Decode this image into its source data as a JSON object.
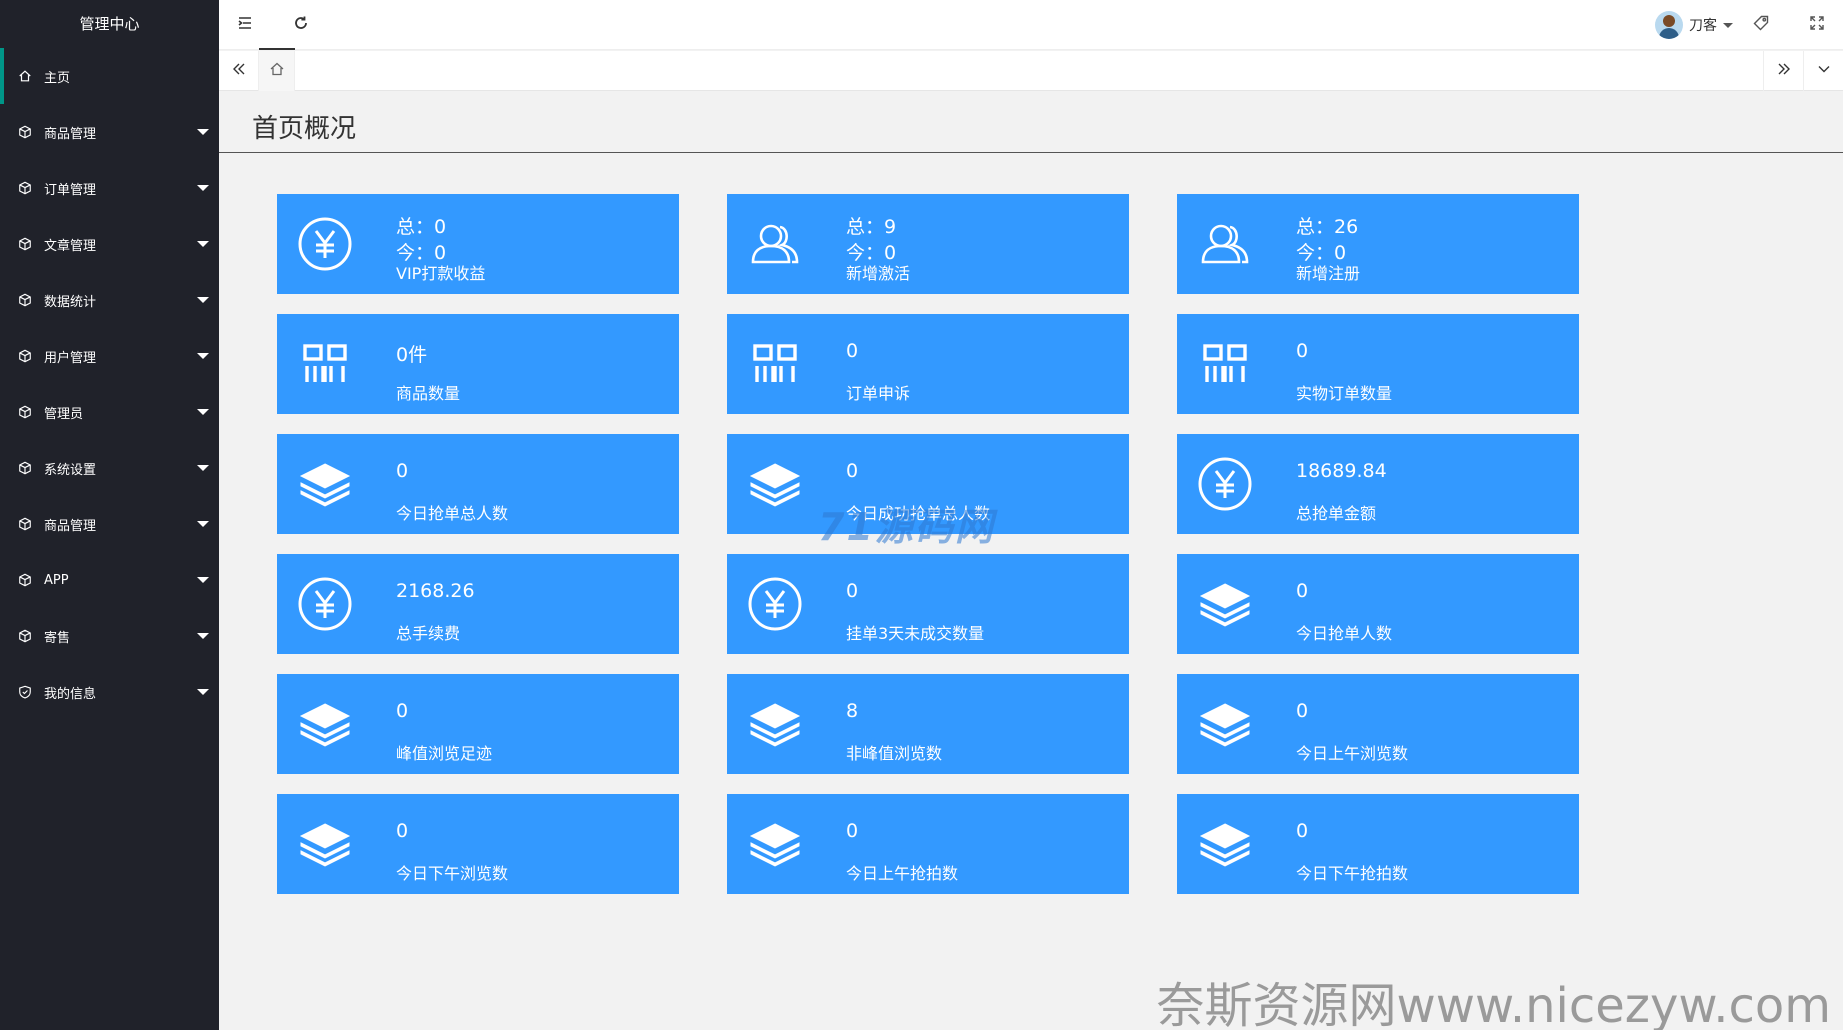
{
  "sidebar": {
    "logo": "管理中心",
    "items": [
      {
        "label": "主页",
        "active": true
      },
      {
        "label": "商品管理"
      },
      {
        "label": "订单管理"
      },
      {
        "label": "文章管理"
      },
      {
        "label": "数据统计"
      },
      {
        "label": "用户管理"
      },
      {
        "label": "管理员"
      },
      {
        "label": "系统设置"
      },
      {
        "label": "商品管理"
      },
      {
        "label": "APP"
      },
      {
        "label": "寄售"
      },
      {
        "label": "我的信息"
      }
    ]
  },
  "header": {
    "username": "刀客",
    "icons": [
      "menu-fold-icon",
      "refresh-icon",
      "tag-icon",
      "fullscreen-icon"
    ]
  },
  "tabs": {
    "home_icon": "home-icon"
  },
  "page": {
    "title": "首页概况"
  },
  "cards": [
    {
      "icon": "yuan-icon",
      "total": "总：0",
      "today": "今：0",
      "label": "VIP打款收益"
    },
    {
      "icon": "users-icon",
      "total": "总：9",
      "today": "今：0",
      "label": "新增激活"
    },
    {
      "icon": "users-icon",
      "total": "总：26",
      "today": "今：0",
      "label": "新增注册"
    },
    {
      "icon": "grid-icon",
      "value": "0件",
      "label": "商品数量"
    },
    {
      "icon": "grid-icon",
      "value": "0",
      "label": "订单申诉"
    },
    {
      "icon": "grid-icon",
      "value": "0",
      "label": "实物订单数量"
    },
    {
      "icon": "layers-icon",
      "value": "0",
      "label": "今日抢单总人数"
    },
    {
      "icon": "layers-icon",
      "value": "0",
      "label": "今日成功抢单总人数"
    },
    {
      "icon": "yuan-icon",
      "value": "18689.84",
      "label": "总抢单金额"
    },
    {
      "icon": "yuan-icon",
      "value": "2168.26",
      "label": "总手续费"
    },
    {
      "icon": "yuan-icon",
      "value": "0",
      "label": "挂单3天未成交数量"
    },
    {
      "icon": "layers-icon",
      "value": "0",
      "label": "今日抢单人数"
    },
    {
      "icon": "layers-icon",
      "value": "0",
      "label": "峰值浏览足迹"
    },
    {
      "icon": "layers-icon",
      "value": "8",
      "label": "非峰值浏览数"
    },
    {
      "icon": "layers-icon",
      "value": "0",
      "label": "今日上午浏览数"
    },
    {
      "icon": "layers-icon",
      "value": "0",
      "label": "今日下午浏览数"
    },
    {
      "icon": "layers-icon",
      "value": "0",
      "label": "今日上午抢拍数"
    },
    {
      "icon": "layers-icon",
      "value": "0",
      "label": "今日下午抢拍数"
    }
  ],
  "watermarks": {
    "center": "71源码网",
    "bottom_right": "奈斯资源网www.nicezyw.com"
  },
  "colors": {
    "sidebar_bg": "#20222a",
    "active_accent": "#009688",
    "card_bg": "#3399ff",
    "page_bg": "#f2f2f2"
  }
}
